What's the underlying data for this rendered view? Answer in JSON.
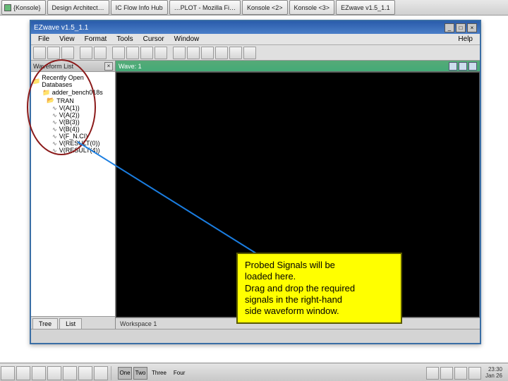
{
  "desktop_tasks": [
    "{Konsole}",
    "Design Architect…",
    "IC Flow Info Hub",
    "…PLOT - Mozilla Fi…",
    "Konsole <2>",
    "Konsole <3>",
    "EZwave v1.5_1.1"
  ],
  "app": {
    "title": "EZwave v1.5_1.1",
    "menu": {
      "file": "File",
      "view": "View",
      "format": "Format",
      "tools": "Tools",
      "cursor": "Cursor",
      "window": "Window",
      "help": "Help"
    }
  },
  "left_panel": {
    "title": "Waveform List",
    "root": "Recently Open Databases",
    "db": "adder_bench018s",
    "analysis": "TRAN",
    "signals": [
      "V(A(1))",
      "V(A(2))",
      "V(B(3))",
      "V(B(4))",
      "V(F_N.CI)",
      "V(RESULT(0))",
      "V(RESULT(4))"
    ],
    "tabs": {
      "tree": "Tree",
      "list": "List"
    }
  },
  "wave": {
    "header": "Wave: 1",
    "workspace": "Workspace 1"
  },
  "annotation": {
    "line1": "Probed Signals will be",
    "line2": "loaded here.",
    "line3": "Drag and drop the required",
    "line4": "signals in the right-hand",
    "line5": "side waveform window."
  },
  "pager": {
    "p0": "One",
    "p1": "Two",
    "p2": "Three",
    "p3": "Four"
  },
  "clock": {
    "time": "23:30",
    "date": "Jan 26"
  }
}
